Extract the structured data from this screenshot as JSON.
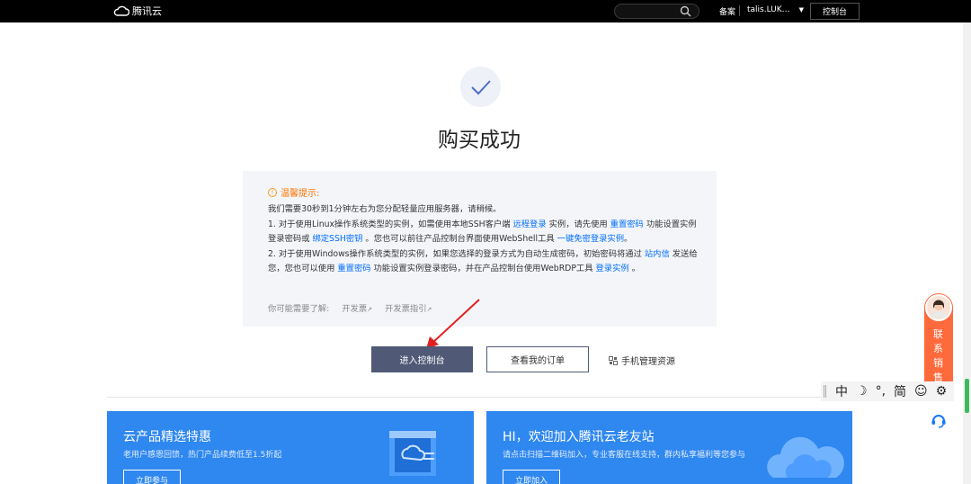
{
  "topbar": {
    "brand": "腾讯云",
    "search_placeholder": "",
    "beian": "备案",
    "user": "talis.LUK…",
    "console": "控制台"
  },
  "success": {
    "title": "购买成功"
  },
  "notice": {
    "heading": "温馨提示:",
    "line1": "我们需要30秒到1分钟左右为您分配轻量应用服务器，请稍候。",
    "p1_a": "1. 对于使用Linux操作系统类型的实例，如需使用本地SSH客户端 ",
    "p1_link1": "远程登录",
    "p1_b": " 实例，请先使用 ",
    "p1_link2": "重置密码",
    "p1_c": " 功能设置实例登录密码或 ",
    "p1_link3": "绑定SSH密钥",
    "p1_d": " 。您也可以前往产品控制台界面使用WebShell工具 ",
    "p1_link4": "一键免密登录实例",
    "p1_e": "。",
    "p2_a": "2. 对于使用Windows操作系统类型的实例，如果您选择的登录方式为自动生成密码，初始密码将通过 ",
    "p2_link1": "站内信",
    "p2_b": " 发送给您，您也可以使用 ",
    "p2_link2": "重置密码",
    "p2_c": " 功能设置实例登录密码，并在产品控制台使用WebRDP工具 ",
    "p2_link3": "登录实例",
    "p2_d": " 。",
    "maybe_label": "你可能需要了解:",
    "maybe_link1": "开发票",
    "maybe_link2": "开发票指引"
  },
  "actions": {
    "enter_console": "进入控制台",
    "view_orders": "查看我的订单",
    "mobile_manage": "手机管理资源"
  },
  "banners": [
    {
      "title": "云产品精选特惠",
      "subtitle": "老用户感恩回馈，热门产品续费低至1.5折起",
      "button": "立即参与"
    },
    {
      "title": "HI，欢迎加入腾讯云老友站",
      "subtitle": "请点击扫描二维码加入，专业客服在线支持，群内私享福利等您参与",
      "button": "立即加入"
    }
  ],
  "side": {
    "sales_text": "联系销售",
    "ime": [
      "中",
      "☽",
      "°,",
      "简",
      "☺",
      "⚙"
    ]
  },
  "colors": {
    "topbar": "#000000",
    "primary_button": "#505a77",
    "link": "#006eff",
    "warning": "#ff7200",
    "banner": "#2f87f0",
    "sales": "#ff6a3d"
  }
}
